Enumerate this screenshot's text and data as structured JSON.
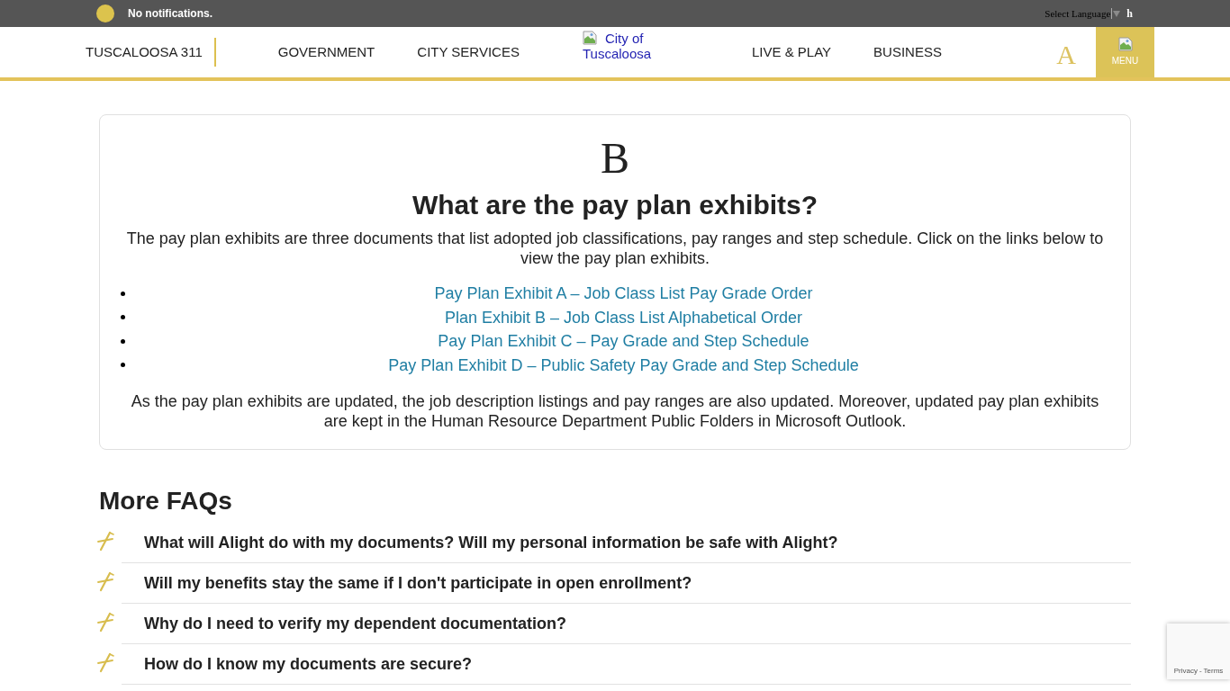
{
  "top_bar": {
    "notification": "No notifications.",
    "language_select": "Select Language",
    "extra_link": "h"
  },
  "header": {
    "home_link": "TUSCALOOSA 311",
    "nav_left": [
      {
        "label": "GOVERNMENT"
      },
      {
        "label": "CITY SERVICES"
      }
    ],
    "logo_alt": "City of Tuscaloosa",
    "nav_right": [
      {
        "label": "LIVE & PLAY"
      },
      {
        "label": "BUSINESS"
      }
    ],
    "text_size_button": "A",
    "menu_button": "MENU"
  },
  "faq_card": {
    "letter": "B",
    "question": "What are the pay plan exhibits?",
    "intro": "The pay plan exhibits are three documents that list adopted job classifications, pay ranges and step schedule.  Click on the links below to view the pay plan exhibits.",
    "links": [
      "Pay Plan Exhibit A – Job Class List Pay Grade Order",
      "Plan Exhibit B – Job Class List Alphabetical Order",
      "Pay Plan Exhibit C – Pay Grade and Step Schedule",
      "Pay Plan Exhibit D – Public Safety Pay Grade and Step Schedule"
    ],
    "closing": "As the pay plan exhibits are updated, the job description listings and pay ranges are also updated. Moreover, updated pay plan exhibits are kept in the Human Resource Department Public Folders in Microsoft Outlook."
  },
  "more_faqs": {
    "title": "More FAQs",
    "items": [
      {
        "question": "What will Alight do with my documents? Will my personal information be safe with Alight?"
      },
      {
        "question": "Will my benefits stay the same if I don't participate in open enrollment?"
      },
      {
        "question": "Why do I need to verify my dependent documentation?"
      },
      {
        "question": "How do I know my documents are secure?"
      }
    ]
  },
  "recaptcha_badge": {
    "links": [
      "Privacy",
      "Terms"
    ],
    "separator": "-"
  }
}
